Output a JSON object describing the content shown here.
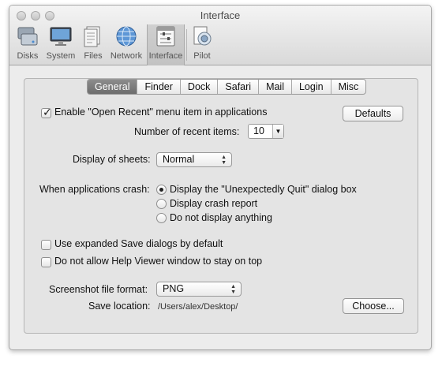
{
  "window": {
    "title": "Interface"
  },
  "toolbar": {
    "items": [
      {
        "label": "Disks",
        "icon": "disks-icon"
      },
      {
        "label": "System",
        "icon": "monitor-icon"
      },
      {
        "label": "Files",
        "icon": "files-icon"
      },
      {
        "label": "Network",
        "icon": "globe-icon"
      },
      {
        "label": "Interface",
        "icon": "interface-icon",
        "selected": true
      },
      {
        "label": "Pilot",
        "icon": "pilot-icon"
      }
    ]
  },
  "tabs": [
    "General",
    "Finder",
    "Dock",
    "Safari",
    "Mail",
    "Login",
    "Misc"
  ],
  "active_tab": "General",
  "general": {
    "open_recent_label": "Enable \"Open Recent\" menu item in applications",
    "open_recent_checked": true,
    "defaults_button": "Defaults",
    "recent_items_label": "Number of recent items:",
    "recent_items_value": "10",
    "sheets_label": "Display of sheets:",
    "sheets_value": "Normal",
    "crash_label": "When applications crash:",
    "crash_options": [
      "Display the \"Unexpectedly Quit\" dialog box",
      "Display crash report",
      "Do not display anything"
    ],
    "crash_selected": 0,
    "expanded_save_label": "Use expanded Save dialogs by default",
    "help_viewer_label": "Do not allow Help Viewer window to stay on top",
    "screenshot_format_label": "Screenshot file format:",
    "screenshot_format_value": "PNG",
    "save_location_label": "Save location:",
    "save_location_value": "/Users/alex/Desktop/",
    "choose_button": "Choose..."
  }
}
